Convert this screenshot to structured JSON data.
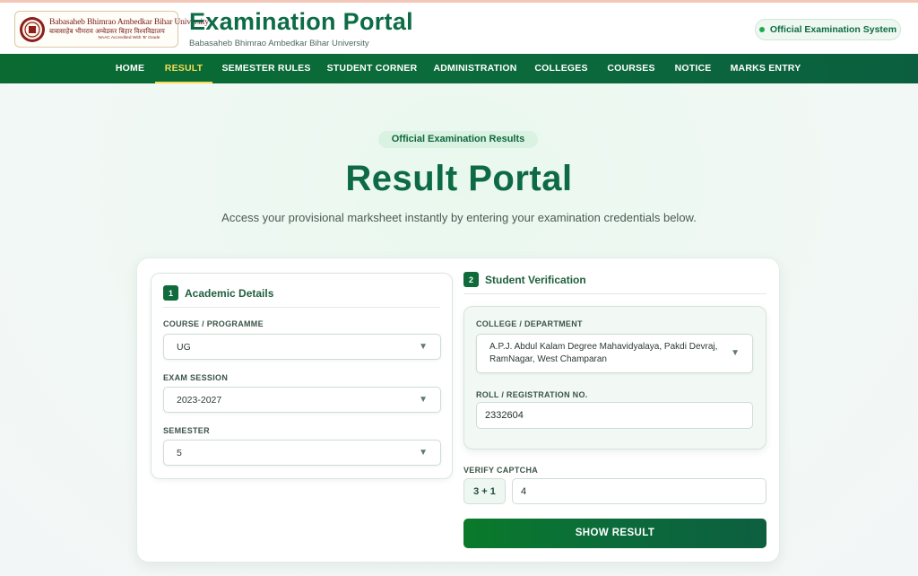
{
  "header": {
    "logo": {
      "name_en": "Babasaheb Bhimrao Ambedkar Bihar University",
      "name_hi": "बाबासाहेब भीमराव अम्बेडकर बिहार विश्वविद्यालय",
      "accreditation": "NAAC Accredited With 'B' Grade"
    },
    "title": "Examination Portal",
    "subtitle": "Babasaheb Bhimrao Ambedkar Bihar University",
    "status_badge": "Official Examination System"
  },
  "nav": {
    "items": [
      {
        "label": "HOME",
        "active": false
      },
      {
        "label": "RESULT",
        "active": true
      },
      {
        "label": "SEMESTER RULES",
        "active": false
      },
      {
        "label": "STUDENT CORNER",
        "active": false
      },
      {
        "label": "ADMINISTRATION",
        "active": false
      },
      {
        "label": "COLLEGES",
        "active": false
      },
      {
        "label": "COURSES",
        "active": false
      },
      {
        "label": "NOTICE",
        "active": false
      },
      {
        "label": "MARKS ENTRY",
        "active": false
      }
    ]
  },
  "hero": {
    "badge": "Official Examination Results",
    "title": "Result Portal",
    "description": "Access your provisional marksheet instantly by entering your examination credentials below."
  },
  "academic": {
    "step": "1",
    "heading": "Academic Details",
    "course_label": "COURSE / PROGRAMME",
    "course_value": "UG",
    "session_label": "EXAM SESSION",
    "session_value": "2023-2027",
    "semester_label": "SEMESTER",
    "semester_value": "5"
  },
  "verification": {
    "step": "2",
    "heading": "Student Verification",
    "college_label": "COLLEGE / DEPARTMENT",
    "college_line1": "A.P.J. Abdul Kalam Degree Mahavidyalaya, Pakdi Devraj,",
    "college_line2": "RamNagar, West Champaran",
    "roll_label": "ROLL / REGISTRATION NO.",
    "roll_value": "2332604",
    "captcha_label": "VERIFY CAPTCHA",
    "captcha_question": "3 + 1",
    "captcha_answer": "4",
    "submit_label": "SHOW RESULT"
  },
  "icons": {
    "select_arrow": "▼",
    "seal": "university-seal-icon",
    "status_dot": "status-dot-icon"
  },
  "colors": {
    "brand_green": "#0c6c45",
    "nav_green": "#0b6b3b",
    "active_nav": "#f4dc55",
    "status_dot": "#1faa52"
  }
}
